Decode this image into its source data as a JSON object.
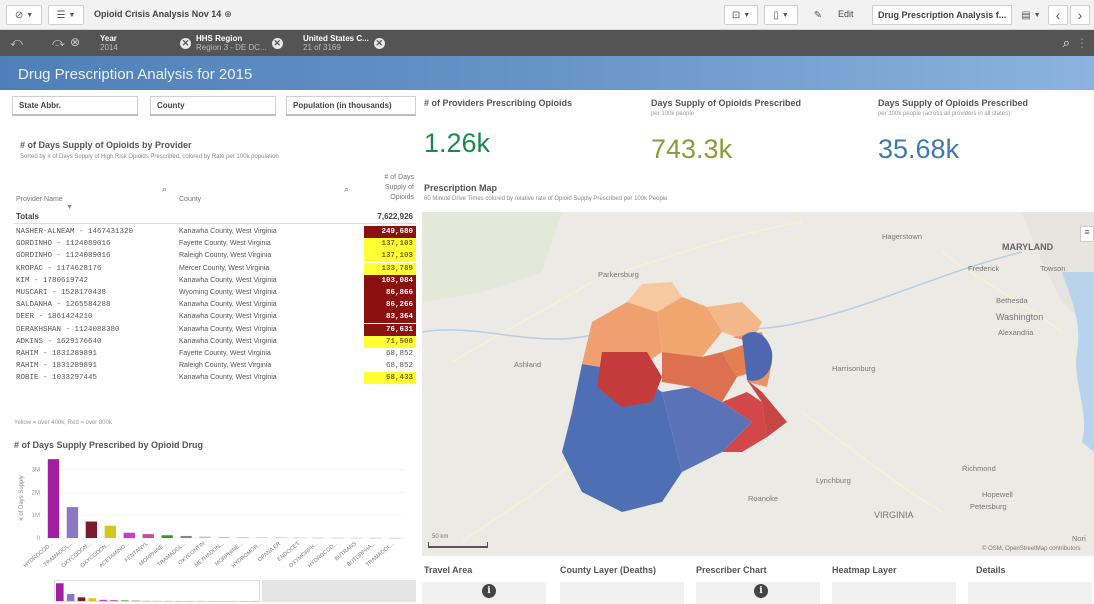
{
  "toolbar": {
    "app_title": "Opioid Crisis Analysis Nov 14",
    "globe_icon": "globe-icon",
    "edit_label": "Edit",
    "sheet_name": "Drug Prescription Analysis f...",
    "prev_icon": "‹",
    "next_icon": "›"
  },
  "selections": [
    {
      "field": "Year",
      "value": "2014"
    },
    {
      "field": "HHS Region",
      "value": "Region 3 - DE DC..."
    },
    {
      "field": "United States C...",
      "value": "21 of 3169"
    }
  ],
  "sheet_title": "Drug Prescription Analysis for 2015",
  "filters": [
    "State Abbr.",
    "County",
    "Population (in thousands)"
  ],
  "provider_table": {
    "title": "# of Days Supply of Opioids by Provider",
    "subtitle": "Sorted by # of Days Supply of High Risk Opioids Prescribed, colored by Rate per 100k population",
    "col_provider": "Provider Name",
    "col_county": "County",
    "col_value_1": "# of Days",
    "col_value_2": "Supply of",
    "col_value_3": "Opioids",
    "totals_label": "Totals",
    "totals_value": "7,622,926",
    "rows": [
      {
        "provider": "NASHER-ALNEAM - 1467431320",
        "county": "Kanawha County, West Virginia",
        "value": "249,680",
        "level": "dark"
      },
      {
        "provider": "GORDINHO - 1124089016",
        "county": "Fayette County, West Virginia",
        "value": "137,103",
        "level": "yellow"
      },
      {
        "provider": "GORDINHO - 1124089016",
        "county": "Raleigh County, West Virginia",
        "value": "137,103",
        "level": "yellow"
      },
      {
        "provider": "KROPAC - 1174628176",
        "county": "Mercer County, West Virginia",
        "value": "133,789",
        "level": "yellow"
      },
      {
        "provider": "KIM - 1780619742",
        "county": "Kanawha County, West Virginia",
        "value": "103,084",
        "level": "dark"
      },
      {
        "provider": "MUSCARI - 1528170438",
        "county": "Wyoming County, West Virginia",
        "value": "86,866",
        "level": "dark"
      },
      {
        "provider": "SALDANHA - 1265584288",
        "county": "Kanawha County, West Virginia",
        "value": "86,266",
        "level": "dark"
      },
      {
        "provider": "DEER - 1861424210",
        "county": "Kanawha County, West Virginia",
        "value": "83,364",
        "level": "dark"
      },
      {
        "provider": "DERAKHSHAN - 1124088380",
        "county": "Kanawha County, West Virginia",
        "value": "76,631",
        "level": "dark"
      },
      {
        "provider": "ADKINS - 1629176640",
        "county": "Kanawha County, West Virginia",
        "value": "71,508",
        "level": "yellow"
      },
      {
        "provider": "RAHIM - 1831289891",
        "county": "Fayette County, West Virginia",
        "value": "68,852",
        "level": "none"
      },
      {
        "provider": "RAHIM - 1831289891",
        "county": "Raleigh County, West Virginia",
        "value": "68,852",
        "level": "none"
      },
      {
        "provider": "ROBIE - 1033297445",
        "county": "Kanawha County, West Virginia",
        "value": "68,433",
        "level": "yellow"
      }
    ],
    "legend_note": "Yellow = over 400k, Red = over 800k"
  },
  "colors": {
    "dark": "#8b1111",
    "yellow": "#ffff33",
    "accent": "#4a7eb8"
  },
  "kpis": [
    {
      "title": "# of Providers Prescribing Opioids",
      "subtitle": "",
      "value": "1.26k",
      "color": "#1c8a4a"
    },
    {
      "title": "Days Supply of Opioids Prescribed",
      "subtitle": "per 100k people",
      "value": "743.3k",
      "color": "#8a9a3a"
    },
    {
      "title": "Days Supply of Opioids Prescribed",
      "subtitle": "per 100k people (across all providers in all states)",
      "value": "35.68k",
      "color": "#3f78b5"
    }
  ],
  "prescription_map": {
    "title": "Prescription Map",
    "subtitle": "60 Minute Drive Times colored by relative rate of Opioid Supply Prescribed per 100k People",
    "labels": [
      "Hagerstown",
      "MARYLAND",
      "Frederick",
      "Towson",
      "Parkersburg",
      "Bethesda",
      "Washington",
      "Alexandria",
      "Ashland",
      "Harrisonburg",
      "Lynchburg",
      "Roanoke",
      "Richmond",
      "Hopewell",
      "Petersburg",
      "VIRGINIA",
      "Nori"
    ],
    "scale": "50 km",
    "credit": "© OSM, OpenStreetMap contributors"
  },
  "chart_data": {
    "type": "bar",
    "title": "# of Days Supply Prescribed by Opioid Drug",
    "ylabel": "# of Days Supply",
    "yticks": [
      "3M",
      "2M",
      "1M",
      "0"
    ],
    "ylim": [
      0,
      3500000
    ],
    "categories": [
      "HYDROCOD...",
      "TRAMADOL...",
      "OXYCODON...",
      "OXYCODON...",
      "ACETAMINO...",
      "FENTANYL",
      "MORPHINE...",
      "TRAMADOL...",
      "OXYCONTIN",
      "METHADON...",
      "MORPHINE...",
      "HYDROMOR...",
      "OPANA ER",
      "ENDOCET",
      "OXYMORPH...",
      "HYDROCOD...",
      "BUTRANS",
      "BUTORPHA...",
      "TRAMADOL..."
    ],
    "values": [
      3450000,
      1350000,
      720000,
      540000,
      230000,
      170000,
      120000,
      90000,
      60000,
      40000,
      30000,
      25000,
      20000,
      15000,
      12000,
      10000,
      8000,
      6000,
      5000
    ],
    "bar_colors": [
      "#a01fa0",
      "#8a78c4",
      "#7b1a2a",
      "#d4c81c",
      "#c83ac8",
      "#d04a9a",
      "#2aa02a",
      "#888888",
      "#bbbbbb",
      "#bbbbbb",
      "#bbbbbb",
      "#bbbbbb",
      "#bbbbbb",
      "#bbbbbb",
      "#bbbbbb",
      "#bbbbbb",
      "#bbbbbb",
      "#bbbbbb",
      "#bbbbbb"
    ]
  },
  "bottom_tabs": [
    "Travel Area",
    "County Layer (Deaths)",
    "Prescriber Chart",
    "Heatmap Layer",
    "Details"
  ]
}
